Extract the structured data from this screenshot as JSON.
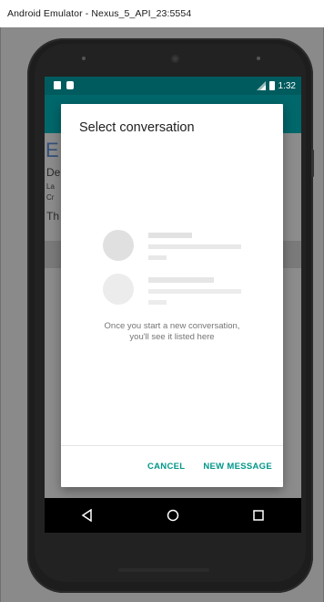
{
  "window": {
    "title": "Android Emulator - Nexus_5_API_23:5554"
  },
  "status_bar": {
    "time": "1:32",
    "left_icons": [
      "sd-card-icon",
      "notification-icon"
    ],
    "right_icons": [
      "signal-icon",
      "battery-icon"
    ]
  },
  "background_app": {
    "accent_text": "E",
    "lines": [
      "De",
      "La",
      "Cr",
      "Th"
    ]
  },
  "dialog": {
    "title": "Select conversation",
    "empty_message": "Once you start a new conversation, you'll see it listed here",
    "actions": {
      "cancel": "CANCEL",
      "new_message": "NEW MESSAGE"
    }
  },
  "nav_bar": {
    "icons": [
      "back-icon",
      "home-icon",
      "recents-icon"
    ]
  },
  "colors": {
    "status_bar": "#005b5e",
    "toolbar": "#00676a",
    "accent": "#009688",
    "placeholder_circle": "#e0e0e0",
    "placeholder_line": "#e4e4e4"
  }
}
